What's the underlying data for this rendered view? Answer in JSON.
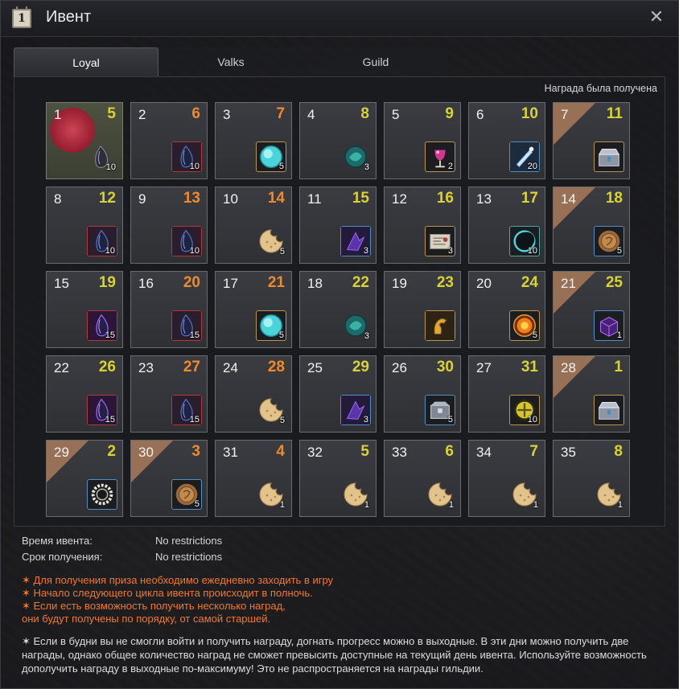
{
  "window": {
    "title": "Ивент",
    "title_icon_text": "1",
    "close": "✕"
  },
  "tabs": [
    {
      "label": "Loyal",
      "active": true
    },
    {
      "label": "Valks",
      "active": false
    },
    {
      "label": "Guild",
      "active": false
    }
  ],
  "status": {
    "received": "Награда была получена"
  },
  "cells": [
    {
      "num": "1",
      "day": "5",
      "day_color": "yellow",
      "item": "black-spirit-stone-icon",
      "frame": "none",
      "count": "10",
      "claimed": true
    },
    {
      "num": "2",
      "day": "6",
      "day_color": "orange",
      "item": "black-stone-icon",
      "frame": "red",
      "count": "10"
    },
    {
      "num": "3",
      "day": "7",
      "day_color": "orange",
      "item": "cyan-orb-icon",
      "frame": "gold",
      "count": "5"
    },
    {
      "num": "4",
      "day": "8",
      "day_color": "yellow",
      "item": "green-crystal-icon",
      "frame": "none",
      "count": "3"
    },
    {
      "num": "5",
      "day": "9",
      "day_color": "yellow",
      "item": "potion-icon",
      "frame": "gold",
      "count": "2"
    },
    {
      "num": "6",
      "day": "10",
      "day_color": "yellow",
      "item": "elixir-vial-icon",
      "frame": "blue",
      "count": "20"
    },
    {
      "num": "7",
      "day": "11",
      "day_color": "yellow",
      "item": "silver-chest-icon",
      "frame": "gold",
      "count": "",
      "special": true
    },
    {
      "num": "8",
      "day": "12",
      "day_color": "yellow",
      "item": "black-stone-icon",
      "frame": "red",
      "count": "10"
    },
    {
      "num": "9",
      "day": "13",
      "day_color": "orange",
      "item": "black-stone-icon",
      "frame": "red",
      "count": "10"
    },
    {
      "num": "10",
      "day": "14",
      "day_color": "orange",
      "item": "cookie-icon",
      "frame": "none",
      "count": "5"
    },
    {
      "num": "11",
      "day": "15",
      "day_color": "yellow",
      "item": "purple-shard-icon",
      "frame": "blue",
      "count": "3"
    },
    {
      "num": "12",
      "day": "16",
      "day_color": "yellow",
      "item": "map-scroll-icon",
      "frame": "gold",
      "count": "3"
    },
    {
      "num": "13",
      "day": "17",
      "day_color": "yellow",
      "item": "eclipse-ring-icon",
      "frame": "teal",
      "count": "10"
    },
    {
      "num": "14",
      "day": "18",
      "day_color": "yellow",
      "item": "bronze-coin-icon",
      "frame": "blue",
      "count": "5",
      "special": true
    },
    {
      "num": "15",
      "day": "19",
      "day_color": "yellow",
      "item": "purple-black-stone-icon",
      "frame": "red",
      "count": "15"
    },
    {
      "num": "16",
      "day": "20",
      "day_color": "orange",
      "item": "black-stone-icon",
      "frame": "red",
      "count": "15"
    },
    {
      "num": "17",
      "day": "21",
      "day_color": "orange",
      "item": "cyan-orb-icon",
      "frame": "gold",
      "count": "5"
    },
    {
      "num": "18",
      "day": "22",
      "day_color": "yellow",
      "item": "green-crystal-icon",
      "frame": "none",
      "count": "3"
    },
    {
      "num": "19",
      "day": "23",
      "day_color": "yellow",
      "item": "golden-horse-icon",
      "frame": "gold",
      "count": ""
    },
    {
      "num": "20",
      "day": "24",
      "day_color": "yellow",
      "item": "fire-orb-icon",
      "frame": "gold",
      "count": "5"
    },
    {
      "num": "21",
      "day": "25",
      "day_color": "yellow",
      "item": "purple-box-icon",
      "frame": "blue",
      "count": "1",
      "special": true
    },
    {
      "num": "22",
      "day": "26",
      "day_color": "yellow",
      "item": "purple-black-stone-icon",
      "frame": "red",
      "count": "15"
    },
    {
      "num": "23",
      "day": "27",
      "day_color": "orange",
      "item": "black-stone-icon",
      "frame": "red",
      "count": "15"
    },
    {
      "num": "24",
      "day": "28",
      "day_color": "orange",
      "item": "cookie-icon",
      "frame": "none",
      "count": "5"
    },
    {
      "num": "25",
      "day": "29",
      "day_color": "yellow",
      "item": "purple-shard-icon",
      "frame": "blue",
      "count": "3"
    },
    {
      "num": "26",
      "day": "30",
      "day_color": "yellow",
      "item": "silver-box-icon",
      "frame": "blue",
      "count": "5"
    },
    {
      "num": "27",
      "day": "31",
      "day_color": "yellow",
      "item": "gold-clover-icon",
      "frame": "gold",
      "count": "10"
    },
    {
      "num": "28",
      "day": "1",
      "day_color": "yellow",
      "item": "silver-chest-icon",
      "frame": "gold",
      "count": "",
      "special": true
    },
    {
      "num": "29",
      "day": "2",
      "day_color": "yellow",
      "item": "gear-ring-icon",
      "frame": "blue",
      "count": "",
      "special": true
    },
    {
      "num": "30",
      "day": "3",
      "day_color": "orange",
      "item": "bronze-coin-icon",
      "frame": "blue",
      "count": "5",
      "special": true
    },
    {
      "num": "31",
      "day": "4",
      "day_color": "orange",
      "item": "cookie-icon",
      "frame": "none",
      "count": "1"
    },
    {
      "num": "32",
      "day": "5",
      "day_color": "yellow",
      "item": "cookie-icon",
      "frame": "none",
      "count": "1"
    },
    {
      "num": "33",
      "day": "6",
      "day_color": "yellow",
      "item": "cookie-icon",
      "frame": "none",
      "count": "1"
    },
    {
      "num": "34",
      "day": "7",
      "day_color": "yellow",
      "item": "cookie-icon",
      "frame": "none",
      "count": "1"
    },
    {
      "num": "35",
      "day": "8",
      "day_color": "yellow",
      "item": "cookie-icon",
      "frame": "none",
      "count": "1"
    }
  ],
  "info": {
    "event_time_label": "Время ивента:",
    "event_time_value": "No restrictions",
    "claim_period_label": "Срок получения:",
    "claim_period_value": "No restrictions"
  },
  "notes": [
    "✶ Для получения приза необходимо ежедневно заходить в игру",
    "✶ Начало следующего цикла ивента происходит в полночь.",
    "✶ Если есть возможность получить несколько наград,",
    "они будут получены по порядку, от самой старшей."
  ],
  "paragraph": "✶ Если в будни вы не смогли войти и получить награду, догнать прогресс можно в выходные. В эти дни можно получить две награды, однако общее количество наград не сможет превысить доступные на текущий день ивента. Используйте возможность дополучить награду в выходные по-максимуму! Это не распространяется на награды гильдии.",
  "colors": {
    "day_yellow": "#d8d335",
    "day_orange": "#f08a2a",
    "note_orange": "#f07a2a",
    "special_corner": "#a87a5a"
  }
}
